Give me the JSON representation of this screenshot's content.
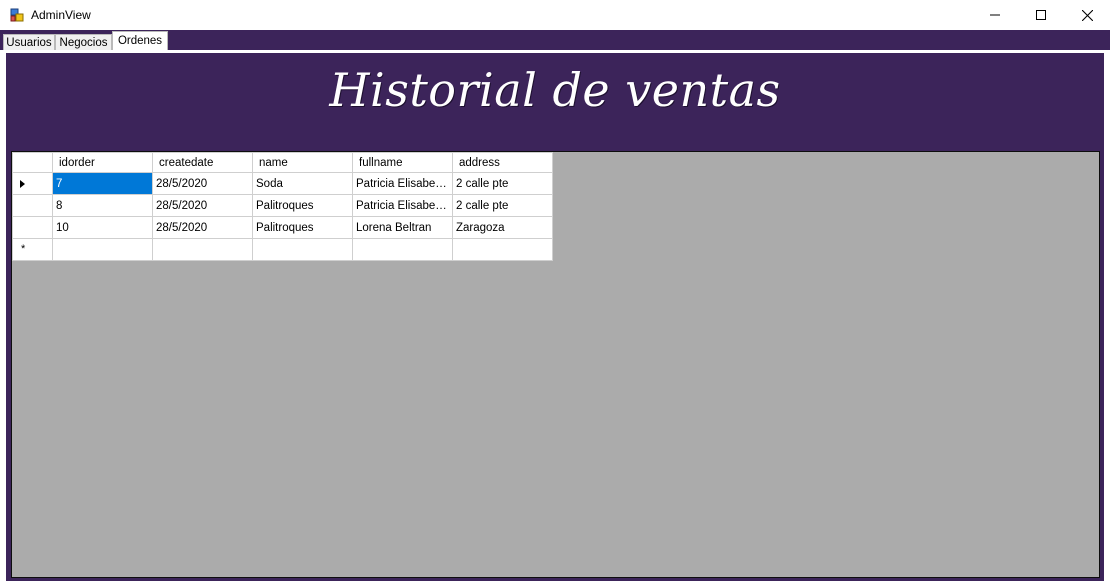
{
  "window": {
    "title": "AdminView",
    "icon": "app-window-icon",
    "controls": [
      "minimize-icon",
      "maximize-icon",
      "close-icon"
    ]
  },
  "tabs": [
    {
      "label": "Usuarios",
      "active": false
    },
    {
      "label": "Negocios",
      "active": false
    },
    {
      "label": "Ordenes",
      "active": true
    }
  ],
  "page": {
    "heading": "Historial de ventas"
  },
  "grid": {
    "columns": [
      "idorder",
      "createdate",
      "name",
      "fullname",
      "address"
    ],
    "rows": [
      {
        "idorder": "7",
        "createdate": "28/5/2020",
        "name": "Soda",
        "fullname": "Patricia Elisabeth...",
        "address": "2 calle pte"
      },
      {
        "idorder": "8",
        "createdate": "28/5/2020",
        "name": "Palitroques",
        "fullname": "Patricia Elisabeth...",
        "address": "2 calle pte"
      },
      {
        "idorder": "10",
        "createdate": "28/5/2020",
        "name": "Palitroques",
        "fullname": "Lorena Beltran",
        "address": "Zaragoza"
      }
    ],
    "new_row_marker": "*",
    "selected_cell": "row 0, idorder"
  },
  "colors": {
    "panel_background": "#3c245a",
    "grid_background": "#ababab",
    "selection": "#0078d7"
  }
}
